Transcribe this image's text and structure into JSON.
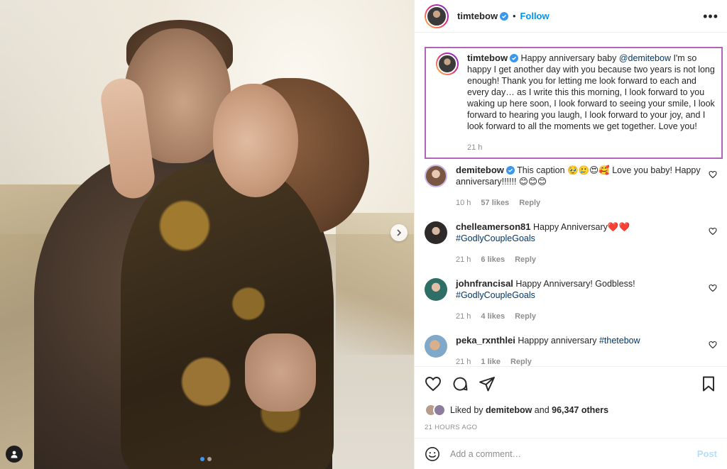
{
  "post": {
    "author": "timtebow",
    "follow_label": "Follow",
    "header_separator": "•",
    "more_label": "•••",
    "carousel": {
      "slides": 2,
      "active": 1
    }
  },
  "caption": {
    "username": "timtebow",
    "mention": "@demitebow",
    "text_before": "Happy anniversary baby ",
    "text_after": " I'm so happy I get another day with you because two years is not long enough! Thank you for letting me look forward to each and every day… as I write this this morning, I look forward to you waking up here soon, I look forward to seeing your smile, I look forward to hearing you laugh, I look forward to your joy, and I look forward to all the moments we get together. Love you!",
    "time": "21 h"
  },
  "comments": [
    {
      "username": "demitebow",
      "verified": true,
      "text": "This caption 🥹🥲😍🥰 Love you baby! Happy anniversary!!!!!! 😊😊😊",
      "hashtag": "",
      "time": "10 h",
      "likes": "57 likes",
      "reply": "Reply"
    },
    {
      "username": "chelleamerson81",
      "verified": false,
      "text": "Happy Anniversary❤️❤️",
      "hashtag": "#GodlyCoupleGoals",
      "time": "21 h",
      "likes": "6 likes",
      "reply": "Reply"
    },
    {
      "username": "johnfrancisal",
      "verified": false,
      "text": "Happy Anniversary! Godbless!",
      "hashtag": "#GodlyCoupleGoals",
      "time": "21 h",
      "likes": "4 likes",
      "reply": "Reply"
    },
    {
      "username": "peka_rxnthlei",
      "verified": false,
      "text": "Happpy anniversary ",
      "hashtag": "#thetebow",
      "time": "21 h",
      "likes": "1 like",
      "reply": "Reply"
    }
  ],
  "engagement": {
    "liked_by_prefix": "Liked by ",
    "liked_by_user": "demitebow",
    "liked_by_mid": " and ",
    "others": "96,347 others",
    "timestamp": "21 HOURS AGO"
  },
  "composer": {
    "placeholder": "Add a comment…",
    "post_label": "Post"
  },
  "colors": {
    "accent": "#0095f6",
    "highlight_border": "#b565b8",
    "muted": "#8e8e8e"
  }
}
